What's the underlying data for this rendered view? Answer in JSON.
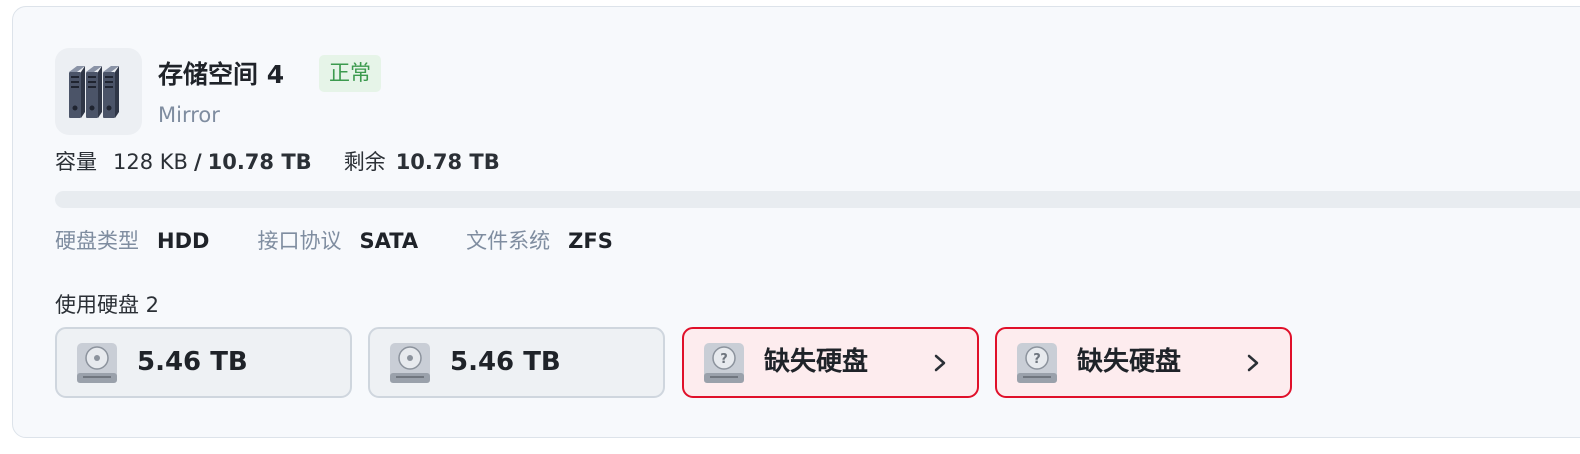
{
  "pool": {
    "name": "存储空间 4",
    "status": "正常",
    "type": "Mirror",
    "icon": "server-rack-icon"
  },
  "capacity": {
    "label": "容量",
    "used": "128 KB",
    "separator": "/",
    "total": "10.78 TB",
    "remaining_label": "剩余",
    "remaining": "10.78 TB",
    "usage_fraction": 0.0
  },
  "meta": {
    "disk_type_label": "硬盘类型",
    "disk_type": "HDD",
    "interface_label": "接口协议",
    "interface": "SATA",
    "filesystem_label": "文件系统",
    "filesystem": "ZFS"
  },
  "disks_section": {
    "label": "使用硬盘 2"
  },
  "disks": [
    {
      "label": "5.46 TB",
      "state": "ok",
      "icon": "hard-drive-icon"
    },
    {
      "label": "5.46 TB",
      "state": "ok",
      "icon": "hard-drive-icon"
    },
    {
      "label": "缺失硬盘",
      "state": "missing",
      "icon": "missing-drive-icon"
    },
    {
      "label": "缺失硬盘",
      "state": "missing",
      "icon": "missing-drive-icon"
    }
  ],
  "colors": {
    "status_ok_bg": "#e6f4e8",
    "status_ok_text": "#3c9a4e",
    "missing_border": "#e0102a",
    "missing_bg": "#fdecee"
  }
}
